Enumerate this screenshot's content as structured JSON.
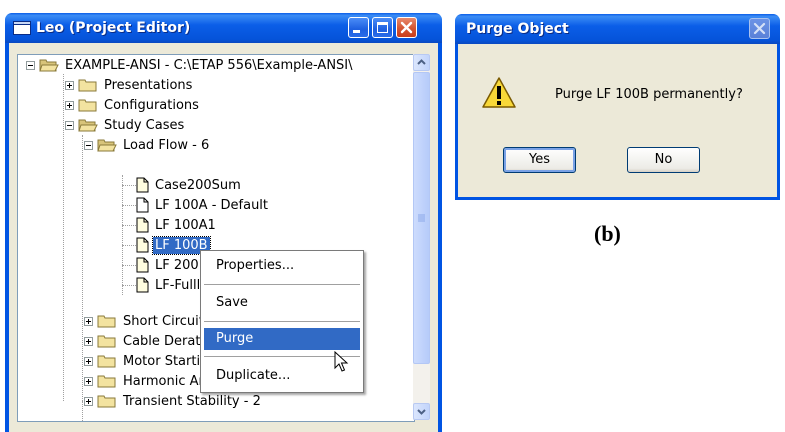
{
  "project_editor": {
    "title": "Leo (Project Editor)",
    "tree": [
      {
        "label": "EXAMPLE-ANSI - C:\\ETAP 556\\Example-ANSI\\",
        "icon": "open-folder-icon",
        "expander": "minus"
      },
      {
        "label": "Presentations",
        "icon": "folder-icon",
        "expander": "plus"
      },
      {
        "label": "Configurations",
        "icon": "folder-icon",
        "expander": "plus"
      },
      {
        "label": "Study Cases",
        "icon": "open-folder-icon",
        "expander": "minus"
      },
      {
        "label": "Load Flow - 6",
        "icon": "open-folder-icon",
        "expander": "minus"
      },
      {
        "label": "Case200Sum",
        "icon": "document-icon"
      },
      {
        "label": "LF 100A - Default",
        "icon": "document-icon"
      },
      {
        "label": "LF 100A1",
        "icon": "document-icon"
      },
      {
        "label": "LF 100B",
        "icon": "document-icon",
        "selected": true
      },
      {
        "label": "LF 200 D",
        "icon": "document-icon"
      },
      {
        "label": "LF-Fulllo",
        "icon": "document-icon"
      },
      {
        "label": "Short Circuit",
        "icon": "folder-icon",
        "expander": "plus"
      },
      {
        "label": "Cable Derat",
        "icon": "folder-icon",
        "expander": "plus"
      },
      {
        "label": "Motor Starti",
        "icon": "folder-icon",
        "expander": "plus"
      },
      {
        "label": "Harmonic An",
        "icon": "folder-icon",
        "expander": "plus"
      },
      {
        "label": "Transient Stability - 2",
        "icon": "folder-icon",
        "expander": "plus"
      }
    ]
  },
  "context_menu": {
    "items": [
      "Properties...",
      "Save",
      "Purge",
      "Duplicate..."
    ],
    "highlighted": "Purge"
  },
  "purge_dialog": {
    "title": "Purge Object",
    "message": "Purge LF 100B permanently?",
    "yes_label": "Yes",
    "no_label": "No"
  },
  "caption": "(b)",
  "colors": {
    "titlebar_blue": "#0054e3",
    "selection_blue": "#316ac5",
    "dialog_face": "#ece9d8",
    "close_red": "#d45532",
    "warning_yellow": "#f8d838"
  }
}
